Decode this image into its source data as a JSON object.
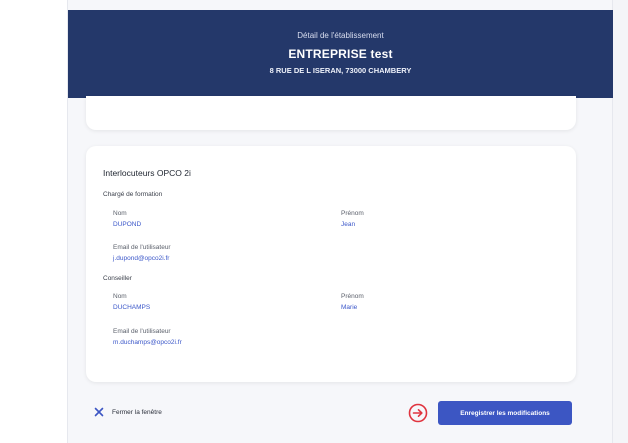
{
  "header": {
    "subtitle": "Détail de l'établissement",
    "title": "ENTREPRISE test",
    "address": "8 RUE DE L ISERAN, 73000 CHAMBERY"
  },
  "interlocuteurs": {
    "title": "Interlocuteurs OPCO 2i",
    "charge_formation": {
      "section_label": "Chargé de formation",
      "nom_label": "Nom",
      "nom_value": "DUPOND",
      "prenom_label": "Prénom",
      "prenom_value": "Jean",
      "email_label": "Email de l'utilisateur",
      "email_value": "j.dupond@opco2i.fr"
    },
    "conseiller": {
      "section_label": "Conseiller",
      "nom_label": "Nom",
      "nom_value": "DUCHAMPS",
      "prenom_label": "Prénom",
      "prenom_value": "Marie",
      "email_label": "Email de l'utilisateur",
      "email_value": "m.duchamps@opco2i.fr"
    }
  },
  "footer": {
    "close_label": "Fermer la fenêtre",
    "save_label": "Enregistrer les modifications"
  },
  "colors": {
    "header_bg": "#24386a",
    "link_blue": "#3b57c9",
    "button_bg": "#3c56c3",
    "arrow_red": "#e0343f"
  },
  "icons": {
    "close": "close-icon",
    "arrow": "arrow-right-circle-icon"
  }
}
